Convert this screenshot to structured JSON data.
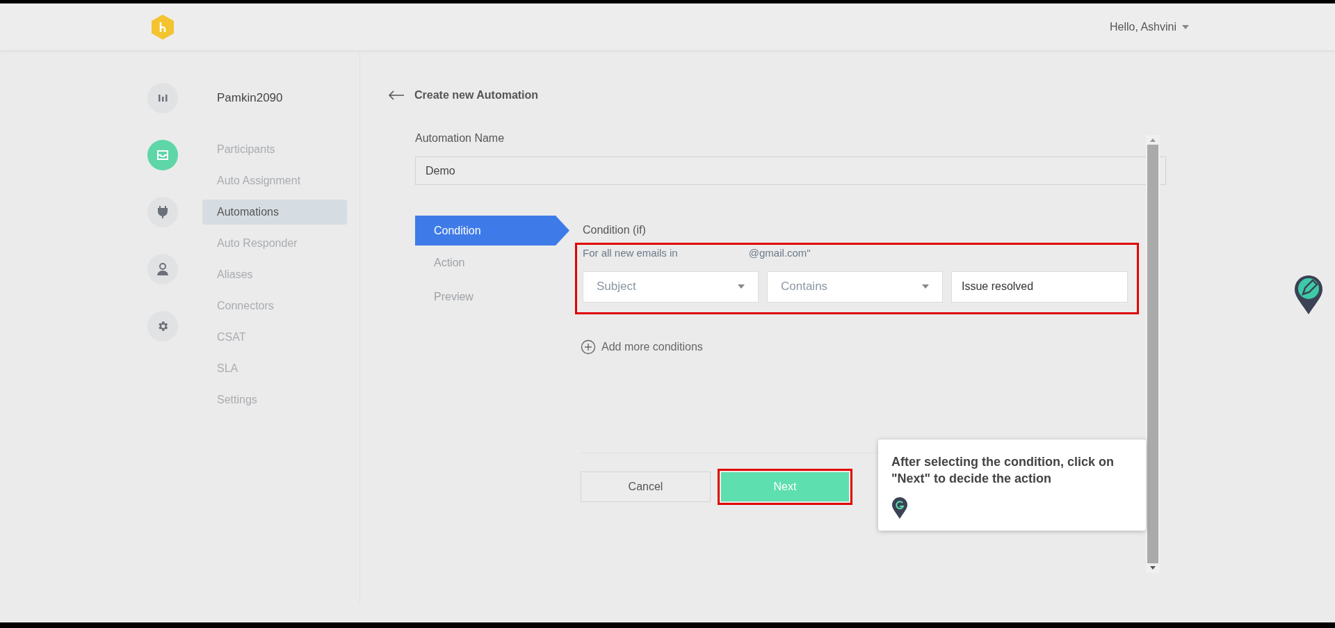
{
  "header": {
    "greeting": "Hello, Ashvini"
  },
  "rail": [
    {
      "kind": "bars",
      "selected": false
    },
    {
      "kind": "inbox",
      "selected": true
    },
    {
      "kind": "plug",
      "selected": false
    },
    {
      "kind": "user",
      "selected": false
    },
    {
      "kind": "gear",
      "selected": false
    }
  ],
  "sidebar": {
    "title": "Pamkin2090",
    "items": [
      {
        "label": "Participants",
        "selected": false
      },
      {
        "label": "Auto Assignment",
        "selected": false
      },
      {
        "label": "Automations",
        "selected": true
      },
      {
        "label": "Auto Responder",
        "selected": false
      },
      {
        "label": "Aliases",
        "selected": false
      },
      {
        "label": "Connectors",
        "selected": false
      },
      {
        "label": "CSAT",
        "selected": false
      },
      {
        "label": "SLA",
        "selected": false
      },
      {
        "label": "Settings",
        "selected": false
      }
    ]
  },
  "page": {
    "title": "Create new Automation",
    "name_label": "Automation Name",
    "name_value": "Demo"
  },
  "steps": [
    {
      "label": "Condition",
      "selected": true
    },
    {
      "label": "Action",
      "selected": false
    },
    {
      "label": "Preview",
      "selected": false
    }
  ],
  "condition": {
    "heading": "Condition (if)",
    "scope_prefix": "For all new emails in",
    "scope_suffix": "@gmail.com\"",
    "field": "Subject",
    "operator": "Contains",
    "value": "Issue resolved",
    "add_more": "Add more conditions"
  },
  "buttons": {
    "cancel": "Cancel",
    "next": "Next"
  },
  "tooltip": {
    "text": "After selecting the condition, click on \"Next\" to decide the action"
  }
}
